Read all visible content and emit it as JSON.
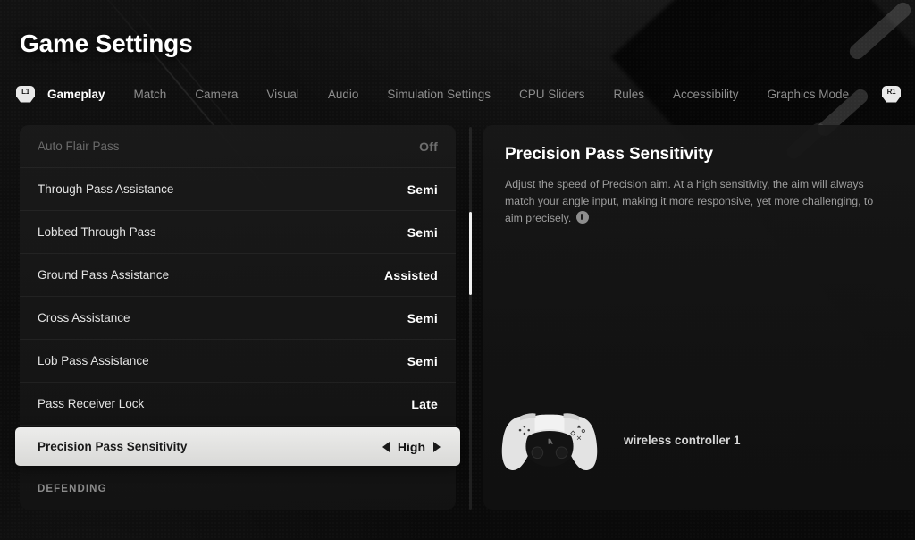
{
  "header": {
    "title": "Game Settings"
  },
  "tabbar": {
    "left_bumper": "L1",
    "right_bumper": "R1",
    "tabs": [
      {
        "label": "Gameplay",
        "active": true
      },
      {
        "label": "Match",
        "active": false
      },
      {
        "label": "Camera",
        "active": false
      },
      {
        "label": "Visual",
        "active": false
      },
      {
        "label": "Audio",
        "active": false
      },
      {
        "label": "Simulation Settings",
        "active": false
      },
      {
        "label": "CPU Sliders",
        "active": false
      },
      {
        "label": "Rules",
        "active": false
      },
      {
        "label": "Accessibility",
        "active": false
      },
      {
        "label": "Graphics Mode",
        "active": false
      }
    ]
  },
  "settings_list": {
    "rows": [
      {
        "label": "Auto Flair Pass",
        "value": "Off",
        "state": "disabled"
      },
      {
        "label": "Through Pass Assistance",
        "value": "Semi",
        "state": "normal"
      },
      {
        "label": "Lobbed Through Pass",
        "value": "Semi",
        "state": "normal"
      },
      {
        "label": "Ground Pass Assistance",
        "value": "Assisted",
        "state": "normal"
      },
      {
        "label": "Cross Assistance",
        "value": "Semi",
        "state": "normal"
      },
      {
        "label": "Lob Pass Assistance",
        "value": "Semi",
        "state": "normal"
      },
      {
        "label": "Pass Receiver Lock",
        "value": "Late",
        "state": "normal"
      },
      {
        "label": "Precision Pass Sensitivity",
        "value": "High",
        "state": "selected"
      },
      {
        "label": "DEFENDING",
        "value": "",
        "state": "section"
      }
    ],
    "selected": {
      "label": "Precision Pass Sensitivity",
      "value": "High",
      "left_arrow": "◀",
      "right_arrow": "▶"
    }
  },
  "detail_panel": {
    "title": "Precision Pass Sensitivity",
    "description": "Adjust the speed of Precision aim. At a high sensitivity, the aim will always match your angle input, making it more responsive, yet more challenging, to aim precisely.",
    "stick_icon": "left-stick-icon"
  },
  "controller": {
    "label": "wireless controller 1",
    "icon": "dualsense-controller-icon"
  },
  "colors": {
    "background": "#0a0a0a",
    "panel": "#1a1a1a",
    "selected_row_bg": "#ececeb",
    "selected_row_text": "#1a1a1a",
    "active_tab": "#ffffff",
    "inactive_tab": "#8d8d8d",
    "scroll_thumb": "#f0f0f0"
  }
}
